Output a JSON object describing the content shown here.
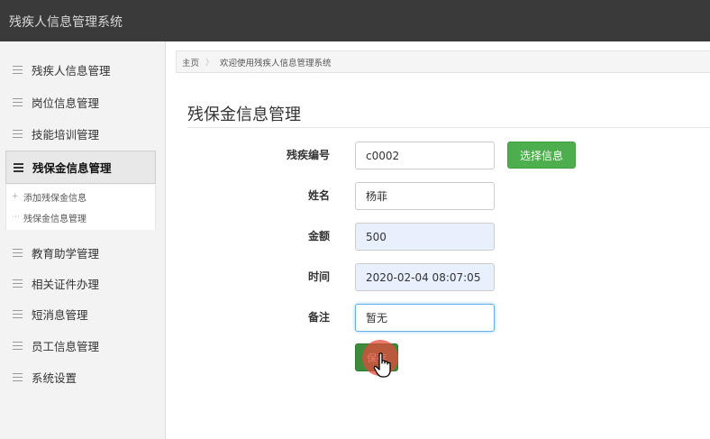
{
  "app": {
    "title": "残疾人信息管理系统"
  },
  "sidebar": {
    "items": [
      {
        "label": "残疾人信息管理"
      },
      {
        "label": "岗位信息管理"
      },
      {
        "label": "技能培训管理"
      },
      {
        "label": "残保金信息管理",
        "active": true
      },
      {
        "label": "教育助学管理"
      },
      {
        "label": "相关证件办理"
      },
      {
        "label": "短消息管理"
      },
      {
        "label": "员工信息管理"
      },
      {
        "label": "系统设置"
      }
    ],
    "submenu": [
      {
        "label": "添加残保金信息",
        "icon": "plus-icon"
      },
      {
        "label": "残保金信息管理",
        "icon": "dash-icon"
      }
    ]
  },
  "breadcrumb": {
    "home": "主页",
    "current": "欢迎使用残疾人信息管理系统"
  },
  "page": {
    "title": "残保金信息管理"
  },
  "form": {
    "disability_id": {
      "label": "残疾编号",
      "value": "c0002"
    },
    "select_button": "选择信息",
    "name": {
      "label": "姓名",
      "value": "杨菲"
    },
    "amount": {
      "label": "金额",
      "value": "500"
    },
    "time": {
      "label": "时间",
      "value": "2020-02-04 08:07:05"
    },
    "remark": {
      "label": "备注",
      "value": "暂无"
    },
    "save_button": "保存"
  },
  "colors": {
    "topbar": "#3a3a3a",
    "success": "#4cae4c",
    "click_highlight": "#e44a3c"
  }
}
